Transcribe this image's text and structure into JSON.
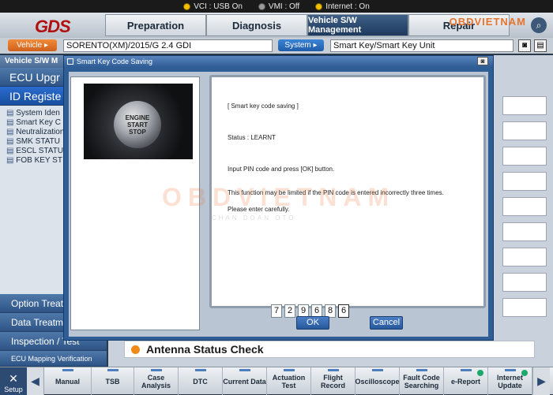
{
  "status": {
    "vci": "VCI : USB On",
    "vmi": "VMI : Off",
    "internet": "Internet : On"
  },
  "header": {
    "logo": "GDS",
    "tabs": [
      "Preparation",
      "Diagnosis",
      "Vehicle S/W Management",
      "Repair"
    ],
    "active_tab": "Vehicle S/W Management",
    "brand": "OBDVIETNAM",
    "brand_sub": "VIETNAM"
  },
  "vehicle_bar": {
    "vehicle_button": "Vehicle",
    "vehicle_value": "SORENTO(XM)/2015/G 2.4 GDI",
    "system_button": "System",
    "system_value": "Smart Key/Smart Key Unit"
  },
  "left": {
    "heading": "Vehicle S/W M",
    "items": [
      "ECU Upgr",
      "ID Registe"
    ],
    "subitems": [
      "System Iden",
      "Smart Key C",
      "Neutralization",
      "SMK STATU",
      "ESCL STATU",
      "FOB KEY ST"
    ],
    "bottom": [
      "Option Treatm",
      "Data Treatm",
      "Inspection / Test",
      "ECU Mapping Verification"
    ]
  },
  "right": {
    "antenna": "Antenna Status Check"
  },
  "dialog": {
    "title": "Smart Key Code Saving",
    "photo_text": [
      "ENGINE",
      "START",
      "STOP"
    ],
    "heading": "[ Smart key code saving ]",
    "status": "Status : LEARNT",
    "line1": "Input PIN code and press [OK] button.",
    "line2": "This function may be limited if the PIN code is entered incorrectly three times.",
    "line3": "Please enter carefully.",
    "pin": [
      "7",
      "2",
      "9",
      "6",
      "8",
      "6"
    ],
    "ok": "OK",
    "cancel": "Cancel"
  },
  "watermark": {
    "main": "OBDVIETNAM",
    "sub": "CHAN DOAN OTO"
  },
  "toolbar": {
    "setup": "Setup",
    "items": [
      "Manual",
      "TSB",
      "Case Analysis",
      "DTC",
      "Current Data",
      "Actuation Test",
      "Flight Record",
      "Oscilloscope",
      "Fault Code Searching",
      "e-Report",
      "Internet Update"
    ]
  },
  "icons": [
    "search-icon",
    "gear-icon",
    "close-icon",
    "chevron-left-icon",
    "chevron-right-icon",
    "camera-icon",
    "print-icon"
  ],
  "colors": {
    "accent_orange": "#f08b1a",
    "header_blue": "#2f5d96",
    "logo_red": "#b01010"
  }
}
